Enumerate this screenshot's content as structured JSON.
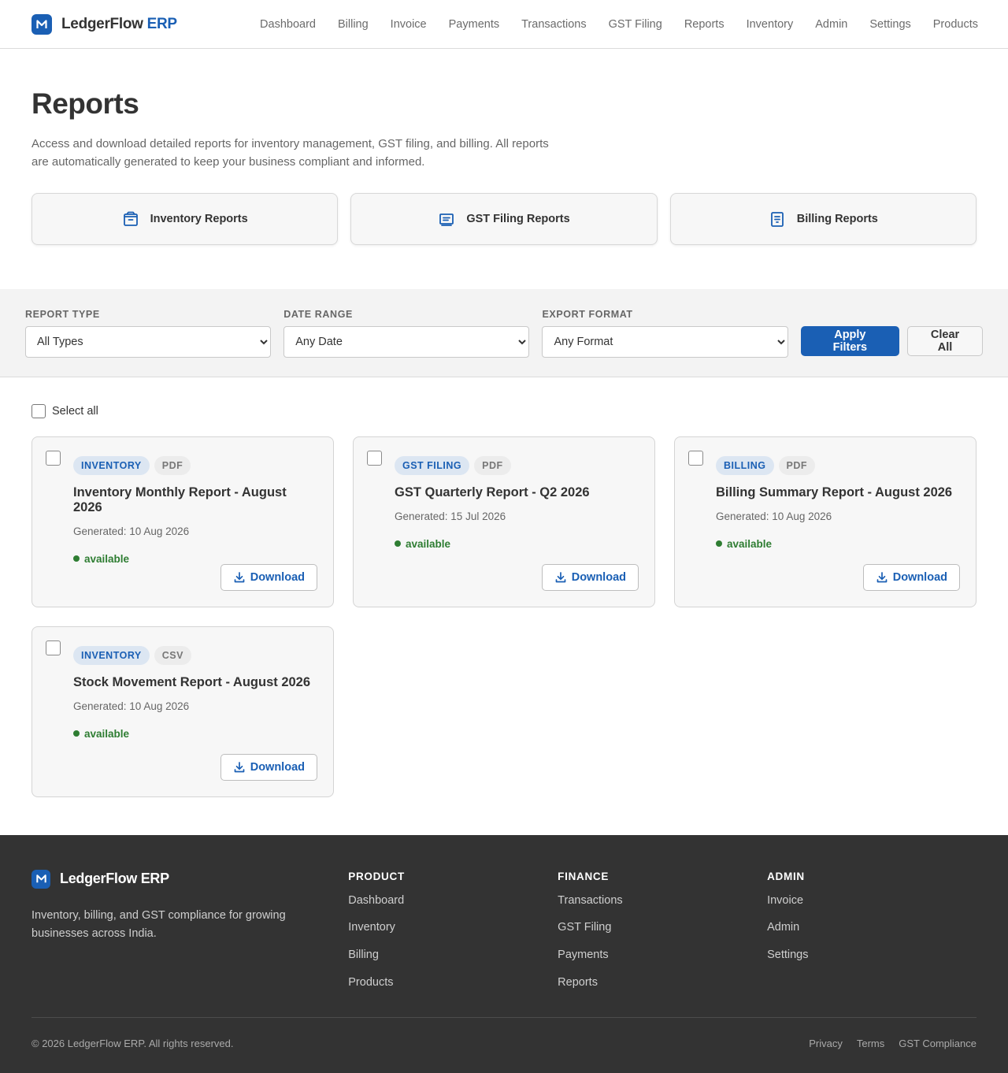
{
  "header": {
    "brand_name": "LedgerFlow",
    "brand_accent": "ERP",
    "nav": [
      "Dashboard",
      "Billing",
      "Invoice",
      "Payments",
      "Transactions",
      "GST Filing",
      "Reports",
      "Inventory",
      "Admin",
      "Settings",
      "Products"
    ]
  },
  "hero": {
    "title": "Reports",
    "description": "Access and download detailed reports for inventory management, GST filing, and billing. All reports are automatically generated to keep your business compliant and informed.",
    "categories": [
      {
        "label": "Inventory Reports",
        "icon": "box-icon"
      },
      {
        "label": "GST Filing Reports",
        "icon": "receipt-icon"
      },
      {
        "label": "Billing Reports",
        "icon": "document-icon"
      }
    ]
  },
  "filters": {
    "report_type_label": "Report Type",
    "report_type_value": "All Types",
    "date_range_label": "Date Range",
    "date_range_value": "Any Date",
    "export_format_label": "Export Format",
    "export_format_value": "Any Format",
    "apply_label": "Apply Filters",
    "clear_label": "Clear All"
  },
  "results": {
    "select_all_label": "Select all",
    "download_label": "Download",
    "reports": [
      {
        "type": "Inventory",
        "format": "PDF",
        "title": "Inventory Monthly Report - August 2026",
        "generated": "Generated: 10 Aug 2026",
        "status": "available"
      },
      {
        "type": "GST Filing",
        "format": "PDF",
        "title": "GST Quarterly Report - Q2 2026",
        "generated": "Generated: 15 Jul 2026",
        "status": "available"
      },
      {
        "type": "Billing",
        "format": "PDF",
        "title": "Billing Summary Report - August 2026",
        "generated": "Generated: 10 Aug 2026",
        "status": "available"
      },
      {
        "type": "Inventory",
        "format": "CSV",
        "title": "Stock Movement Report - August 2026",
        "generated": "Generated: 10 Aug 2026",
        "status": "available"
      }
    ]
  },
  "footer": {
    "brand_name": "LedgerFlow ERP",
    "description": "Inventory, billing, and GST compliance for growing businesses across India.",
    "columns": [
      {
        "heading": "PRODUCT",
        "links": [
          "Dashboard",
          "Inventory",
          "Billing",
          "Products"
        ]
      },
      {
        "heading": "FINANCE",
        "links": [
          "Transactions",
          "GST Filing",
          "Payments",
          "Reports"
        ]
      },
      {
        "heading": "ADMIN",
        "links": [
          "Invoice",
          "Admin",
          "Settings"
        ]
      }
    ],
    "copyright": "© 2026 LedgerFlow ERP. All rights reserved.",
    "legal_links": [
      "Privacy",
      "Terms",
      "GST Compliance"
    ]
  },
  "colors": {
    "primary": "#1a5fb4",
    "status_available": "#2e7d32",
    "footer_bg": "#333333"
  }
}
